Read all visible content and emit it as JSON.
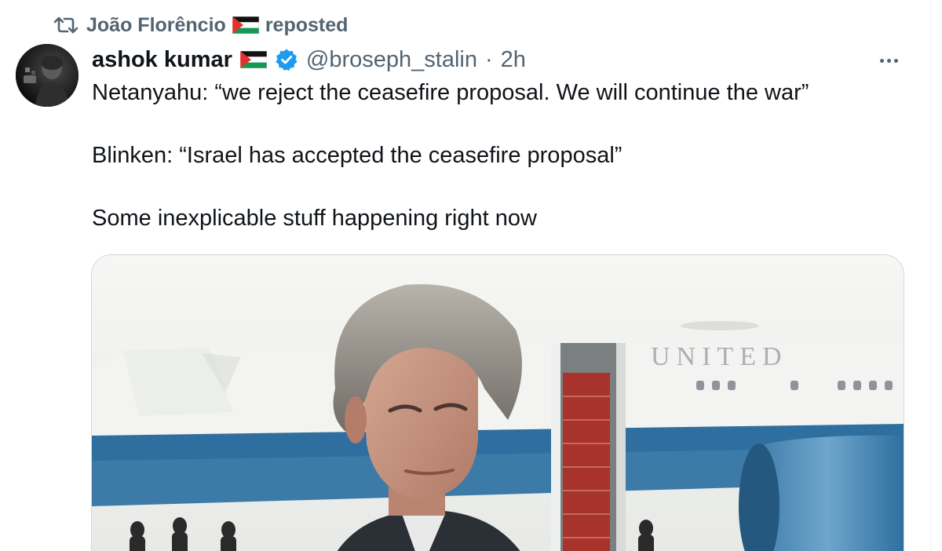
{
  "repost": {
    "icon": "repost-icon",
    "reposter_name": "João Florêncio",
    "reposter_flag": "palestine-flag",
    "action": "reposted"
  },
  "author": {
    "display_name": "ashok kumar",
    "flag": "palestine-flag",
    "verified": true,
    "handle": "@broseph_stalin",
    "separator": "·",
    "time": "2h"
  },
  "menu": {
    "icon": "more-options-icon"
  },
  "tweet": {
    "lines": [
      "Netanyahu: “we reject the ceasefire proposal. We will continue the war”",
      "Blinken: “Israel has accepted the ceasefire proposal”",
      "Some inexplicable stuff happening right now"
    ]
  },
  "media": {
    "plane_lettering": "UNITED",
    "colors": {
      "sky": "#eef0ee",
      "plane_blue": "#2f6f9f",
      "plane_white": "#f4f5f4",
      "stair_red": "#a8322c"
    }
  },
  "colors": {
    "text_primary": "#0f1419",
    "text_secondary": "#536471",
    "verified_blue": "#1d9bf0",
    "border": "#cfd9de"
  }
}
